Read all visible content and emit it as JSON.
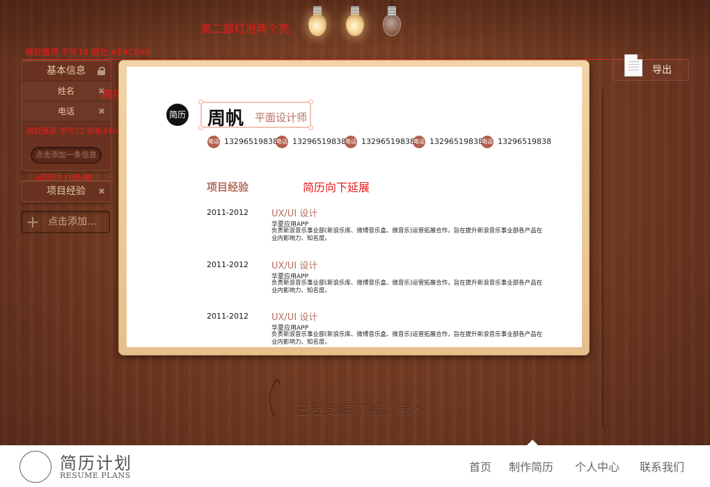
{
  "annotations": {
    "bulbs": "第二部灯泡两个亮",
    "sidebar_title_font": "微软雅黑 字号14 颜色 #E4C8A0",
    "row_height": "高度30像素",
    "row_font": "微软雅黑 字号12 颜色#E4C8A0",
    "spacing": "间距10像素",
    "resume_extend": "简历向下延展"
  },
  "bulbs": [
    {
      "state": "on"
    },
    {
      "state": "on"
    },
    {
      "state": "off"
    }
  ],
  "sidebar": {
    "panel_title": "基本信息",
    "rows": [
      {
        "label": "姓名"
      },
      {
        "label": "电话"
      }
    ],
    "add_info_label": "点击添加一条信息",
    "section_label": "项目经验",
    "add_section_label": "点击添加..."
  },
  "toolbar": {
    "export_label": "导出"
  },
  "resume": {
    "badge": "简历",
    "name": "周帆",
    "job_title": "平面设计师",
    "contacts": [
      {
        "tag": "电话",
        "value": "13296519838"
      },
      {
        "tag": "电话",
        "value": "13296519838"
      },
      {
        "tag": "电话",
        "value": "13296519838"
      },
      {
        "tag": "电话",
        "value": "13296519838"
      },
      {
        "tag": "电话",
        "value": "13296519838"
      }
    ],
    "section_title": "项目经验",
    "experiences": [
      {
        "date": "2011-2012",
        "role": "UX/UI 设计",
        "company": "华夏应用APP",
        "desc": "负责新浪音乐事业部(新浪乐库、微博音乐盒、微音乐)运营拓展合作，旨在提升新浪音乐事业部各产品在业内影响力、知名度。"
      },
      {
        "date": "2011-2012",
        "role": "UX/UI 设计",
        "company": "华夏应用APP",
        "desc": "负责新浪音乐事业部(新浪乐库、微博音乐盒、微音乐)运营拓展合作，旨在提升新浪音乐事业部各产品在业内影响力、知名度。"
      },
      {
        "date": "2011-2012",
        "role": "UX/UI 设计",
        "company": "华夏应用APP",
        "desc": "负责新浪音乐事业部(新浪乐库、微博音乐盒、微音乐)运营拓展合作，旨在提升新浪音乐事业部各产品在业内影响力、知名度。"
      }
    ]
  },
  "end_message": "已经到底了喔，亲～",
  "footer": {
    "logo_cn": "简历计划",
    "logo_en": "RESUME PLANS",
    "nav": [
      {
        "label": "首页"
      },
      {
        "label": "制作简历"
      },
      {
        "label": "个人中心"
      },
      {
        "label": "联系我们"
      }
    ]
  },
  "colors": {
    "sidebar_text": "#E4C8A0",
    "accent": "#B46F5E",
    "annotation": "#E81B1B"
  }
}
